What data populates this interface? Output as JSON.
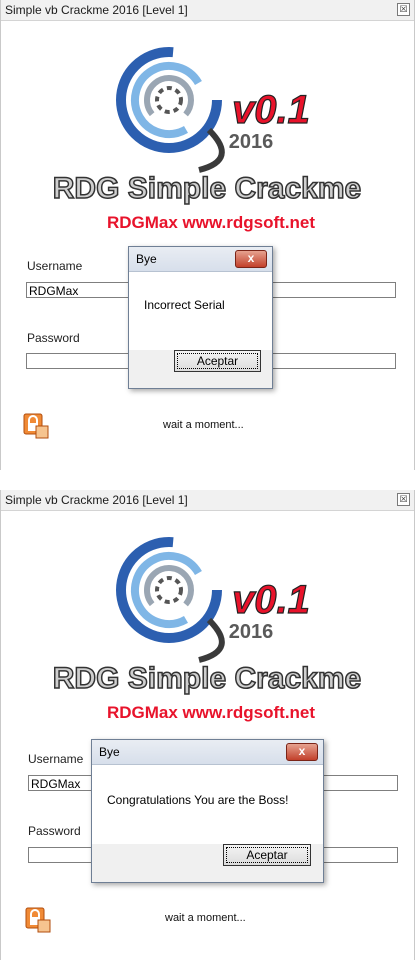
{
  "screens": [
    {
      "window_title": "Simple vb Crackme 2016 [Level 1]",
      "close_glyph": "☒",
      "logo": {
        "version": "v0.1",
        "year": "2016",
        "title": "RDG Simple Crackme",
        "subtitle": "RDGMax www.rdgsoft.net"
      },
      "username_label": "Username",
      "username_value": "RDGMax",
      "password_label": "Password",
      "password_value": "",
      "status_text": "wait a moment...",
      "icon": "lock-icon",
      "dialog": {
        "title": "Bye",
        "message": "Incorrect Serial",
        "button": "Aceptar",
        "close": "x"
      }
    },
    {
      "window_title": "Simple vb Crackme 2016 [Level 1]",
      "close_glyph": "☒",
      "logo": {
        "version": "v0.1",
        "year": "2016",
        "title": "RDG Simple Crackme",
        "subtitle": "RDGMax www.rdgsoft.net"
      },
      "username_label": "Username",
      "username_value": "RDGMax",
      "password_label": "Password",
      "password_value": "",
      "status_text": "wait a moment...",
      "icon": "lock-icon",
      "dialog": {
        "title": "Bye",
        "message": "Congratulations You are the Boss!",
        "button": "Aceptar",
        "close": "x"
      }
    }
  ],
  "colors": {
    "brand_red": "#e8132b",
    "spiral_blue": "#2c5fb0",
    "logo_gray": "#5a5a5a"
  }
}
